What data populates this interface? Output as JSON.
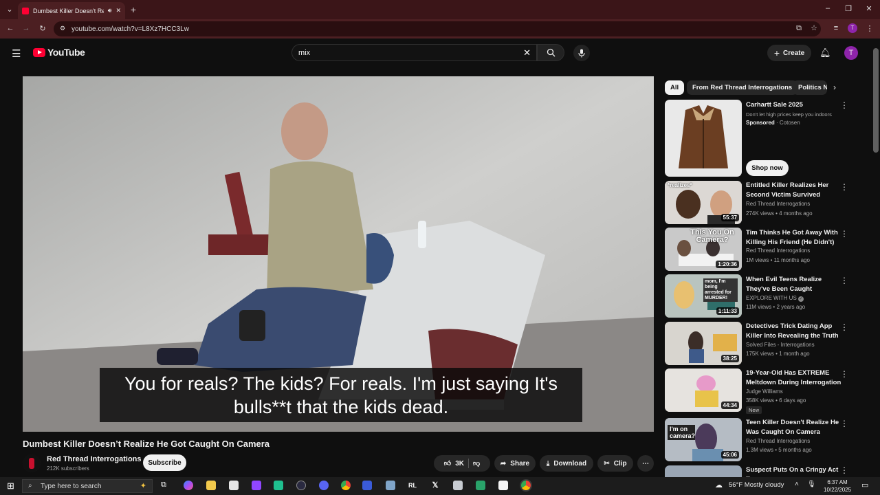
{
  "browser": {
    "tab_title": "Dumbest Killer Doesn't Rea",
    "url": "youtube.com/watch?v=L8Xz7HCC3Lw"
  },
  "youtube": {
    "logo_text": "YouTube",
    "search_value": "mix",
    "create_label": "Create",
    "avatar_letter": "T"
  },
  "video": {
    "caption_line1": "You for reals? The kids? For reals. I'm just saying It's",
    "caption_line2": "bulls**t that the kids dead.",
    "title": "Dumbest Killer Doesn’t Realize He Got Caught On Camera",
    "channel": "Red Thread Interrogations",
    "subscribers": "212K subscribers",
    "subscribe_label": "Subscribe",
    "likes": "3K",
    "share_label": "Share",
    "download_label": "Download",
    "clip_label": "Clip"
  },
  "chips": [
    "All",
    "From Red Thread Interrogations",
    "Politics N"
  ],
  "ad": {
    "title": "Carhartt Sale 2025",
    "desc": "Don't let high prices keep you indoors",
    "sponsored": "Sponsored",
    "advertiser": "· Cotosen",
    "cta": "Shop now"
  },
  "recommendations": [
    {
      "title": "Entitled Killer Realizes Her Second Victim Survived",
      "channel": "Red Thread Interrogations",
      "meta": "274K views • 4 months ago",
      "duration": "55:37"
    },
    {
      "title": "Tim Thinks He Got Away With Killing His Friend (He Didn't)",
      "channel": "Red Thread Interrogations",
      "meta": "1M views • 11 months ago",
      "duration": "1:20:36"
    },
    {
      "title": "When Evil Teens Realize They've Been Caught",
      "channel": "EXPLORE WITH US",
      "meta": "11M views • 2 years ago",
      "duration": "1:11:33"
    },
    {
      "title": "Detectives Trick Dating App Killer Into Revealing the Truth",
      "channel": "Solved Files - Interrogations",
      "meta": "175K views • 1 month ago",
      "duration": "38:25"
    },
    {
      "title": "19-Year-Old Has EXTREME Meltdown During Interrogation",
      "channel": "Judge Williams",
      "meta": "358K views • 6 days ago",
      "duration": "44:34",
      "badge": "New"
    },
    {
      "title": "Teen Killer Doesn't Realize He Was Caught On Camera",
      "channel": "Red Thread Interrogations",
      "meta": "1.3M views • 5 months ago",
      "duration": "45:06"
    },
    {
      "title": "Suspect Puts On a Cringy Act To",
      "channel": "",
      "meta": "",
      "duration": ""
    }
  ],
  "thumb_text": {
    "r0": "*realizes*",
    "r1": "This You On Camera?",
    "r2": "mom, I'm being arrested for MURDER!",
    "r5": "I'm on camera?"
  },
  "taskbar": {
    "search_placeholder": "Type here to search",
    "weather": "56°F  Mostly cloudy",
    "time": "6:37 AM",
    "date": "10/22/2025"
  }
}
